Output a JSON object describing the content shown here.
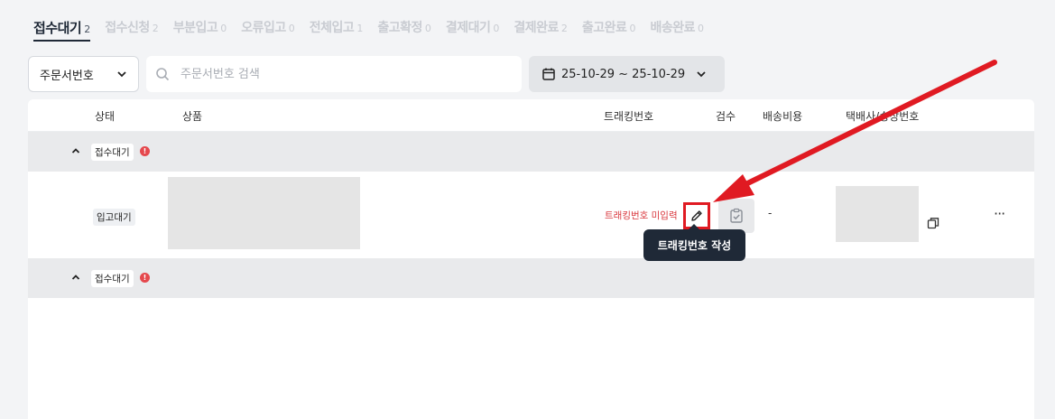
{
  "tabs": [
    {
      "label": "접수대기",
      "count": "2",
      "active": true
    },
    {
      "label": "접수신청",
      "count": "2"
    },
    {
      "label": "부분입고",
      "count": "0"
    },
    {
      "label": "오류입고",
      "count": "0"
    },
    {
      "label": "전체입고",
      "count": "1"
    },
    {
      "label": "출고확정",
      "count": "0"
    },
    {
      "label": "결제대기",
      "count": "0"
    },
    {
      "label": "결제완료",
      "count": "2"
    },
    {
      "label": "출고완료",
      "count": "0"
    },
    {
      "label": "배송완료",
      "count": "0"
    }
  ],
  "filters": {
    "search_type": "주문서번호",
    "search_placeholder": "주문서번호 검색",
    "date_range": "25-10-29 ~ 25-10-29"
  },
  "table": {
    "headers": {
      "status": "상태",
      "product": "상품",
      "tracking": "트래킹번호",
      "inspection": "검수",
      "shipping_cost": "배송비용",
      "courier": "택배사/송장번호"
    },
    "groups": [
      {
        "status": "접수대기",
        "alert": "!"
      },
      {
        "status": "접수대기",
        "alert": "!"
      }
    ],
    "item": {
      "status": "입고대기",
      "tracking_missing": "트래킹번호 미입력",
      "shipping_cost": "-",
      "more": "···"
    }
  },
  "tooltip": "트래킹번호 작성",
  "colors": {
    "accent_red": "#e01a22",
    "tooltip_bg": "#1f2937",
    "alert": "#e5484d"
  }
}
